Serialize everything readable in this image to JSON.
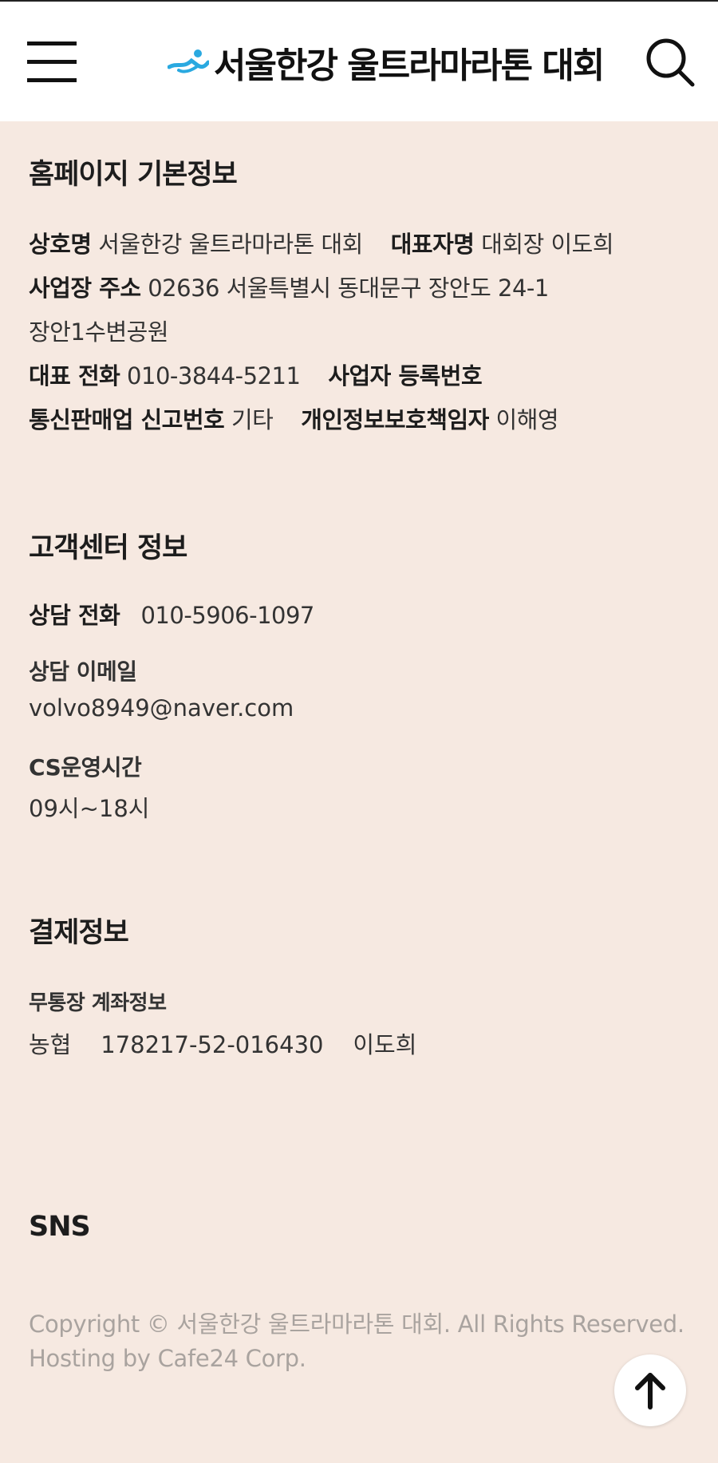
{
  "header": {
    "logo_text": "서울한강 울트라마라톤 대회",
    "brand_color": "#2aa9e0"
  },
  "site_info": {
    "title": "홈페이지 기본정보",
    "company_label": "상호명",
    "company_value": "서울한강 울트라마라톤 대회",
    "ceo_label": "대표자명",
    "ceo_value": "대회장 이도희",
    "address_label": "사업장 주소",
    "address_value": "02636 서울특별시 동대문구 장안도 24-1",
    "address_value_2": "장안1수변공원",
    "phone_label": "대표 전화",
    "phone_value": "010-3844-5211",
    "biz_reg_label": "사업자 등록번호",
    "mail_order_label": "통신판매업 신고번호",
    "mail_order_value": "기타",
    "privacy_officer_label": "개인정보보호책임자",
    "privacy_officer_value": "이해영"
  },
  "customer_center": {
    "title": "고객센터 정보",
    "phone_label": "상담 전화",
    "phone_value": "010-5906-1097",
    "email_label": "상담 이메일",
    "email_value": "volvo8949@naver.com",
    "hours_label": "CS운영시간",
    "hours_value": "09시~18시"
  },
  "payment": {
    "title": "결제정보",
    "account_label": "무통장 계좌정보",
    "bank": "농협",
    "account_number": "178217-52-016430",
    "account_holder": "이도희"
  },
  "sns": {
    "title": "SNS"
  },
  "footer": {
    "copyright": "Copyright © 서울한강 울트라마라톤 대회. All Rights Reserved.",
    "hosting": "Hosting by Cafe24 Corp."
  },
  "icons": {
    "menu": "hamburger-menu-icon",
    "search": "search-icon",
    "top": "arrow-up-icon"
  }
}
